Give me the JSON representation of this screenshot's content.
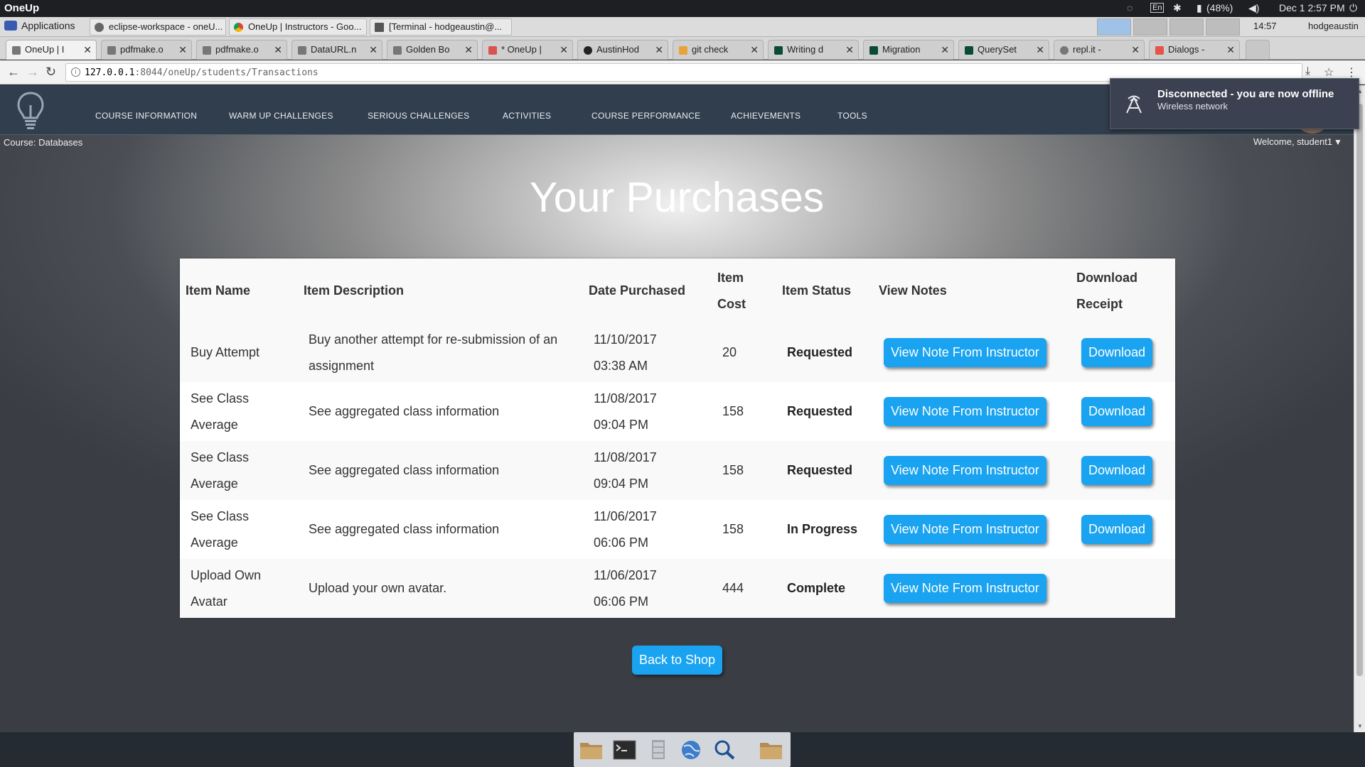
{
  "system": {
    "app_name": "OneUp",
    "battery": "(48%)",
    "datetime": "Dec 1  2:57 PM",
    "lang": "En"
  },
  "panel": {
    "applications_label": "Applications",
    "tasks": [
      "eclipse-workspace - oneU...",
      "OneUp | Instructors - Goo...",
      "[Terminal - hodgeaustin@..."
    ],
    "clock": "14:57",
    "user": "hodgeaustin"
  },
  "browser": {
    "tabs": [
      "OneUp | I",
      "pdfmake.o",
      "pdfmake.o",
      "DataURL.n",
      "Golden Bo",
      "* OneUp |",
      "AustinHod",
      "git check",
      "Writing d",
      "Migration",
      "QuerySet",
      "repl.it -",
      "Dialogs -"
    ],
    "url_host": "127.0.0.1",
    "url_rest": ":8044/oneUp/students/Transactions"
  },
  "site": {
    "menu": [
      "COURSE INFORMATION",
      "WARM UP CHALLENGES",
      "SERIOUS CHALLENGES",
      "ACTIVITIES",
      "COURSE PERFORMANCE",
      "ACHIEVEMENTS",
      "TOOLS"
    ],
    "course": "Course: Databases",
    "welcome": "Welcome, student1"
  },
  "notification": {
    "title": "Disconnected - you are now offline",
    "subtitle": "Wireless network"
  },
  "purchases": {
    "title": "Your Purchases",
    "headers": {
      "name": "Item Name",
      "description": "Item Description",
      "date": "Date Purchased",
      "cost_1": "Item",
      "cost_2": "Cost",
      "status": "Item Status",
      "notes": "View Notes",
      "receipt_1": "Download",
      "receipt_2": "Receipt"
    },
    "rows": [
      {
        "name": "Buy Attempt",
        "description": "Buy another attempt for re-submission of an assignment",
        "date": "11/10/2017",
        "time": "03:38 AM",
        "cost": "20",
        "status": "Requested",
        "note_label": "View Note From Instructor",
        "download_label": "Download"
      },
      {
        "name": "See Class Average",
        "description": "See aggregated class information",
        "date": "11/08/2017",
        "time": "09:04 PM",
        "cost": "158",
        "status": "Requested",
        "note_label": "View Note From Instructor",
        "download_label": "Download"
      },
      {
        "name": "See Class Average",
        "description": "See aggregated class information",
        "date": "11/08/2017",
        "time": "09:04 PM",
        "cost": "158",
        "status": "Requested",
        "note_label": "View Note From Instructor",
        "download_label": "Download"
      },
      {
        "name": "See Class Average",
        "description": "See aggregated class information",
        "date": "11/06/2017",
        "time": "06:06 PM",
        "cost": "158",
        "status": "In Progress",
        "note_label": "View Note From Instructor",
        "download_label": "Download"
      },
      {
        "name": "Upload Own Avatar",
        "description": "Upload your own avatar.",
        "date": "11/06/2017",
        "time": "06:06 PM",
        "cost": "444",
        "status": "Complete",
        "note_label": "View Note From Instructor",
        "download_label": ""
      }
    ],
    "back_label": "Back to Shop"
  }
}
